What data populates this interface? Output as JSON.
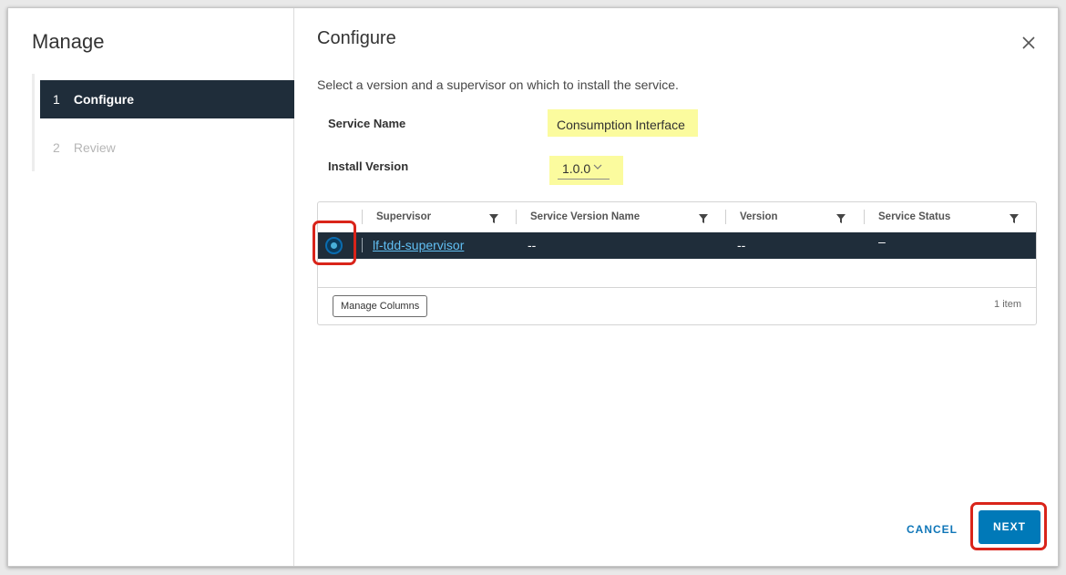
{
  "sidebar": {
    "title": "Manage",
    "steps": [
      {
        "number": "1",
        "label": "Configure",
        "active": true
      },
      {
        "number": "2",
        "label": "Review",
        "active": false
      }
    ]
  },
  "main": {
    "title": "Configure",
    "description": "Select a version and a supervisor on which to install the service.",
    "service_name_label": "Service Name",
    "service_name_value": "Consumption Interface",
    "install_version_label": "Install Version",
    "install_version_value": "1.0.0",
    "icons": {
      "close": "close-icon",
      "version_dropdown": "chevron-down-icon",
      "filter": "filter-icon"
    }
  },
  "grid": {
    "columns": [
      "Supervisor",
      "Service Version Name",
      "Version",
      "Service Status"
    ],
    "rows": [
      {
        "supervisor": "lf-tdd-supervisor",
        "service_version_name": "--",
        "version": "--",
        "service_status": "–",
        "selected": true
      }
    ],
    "manage_columns_label": "Manage Columns",
    "item_count": "1 item"
  },
  "footer": {
    "cancel_label": "CANCEL",
    "next_label": "NEXT"
  },
  "colors": {
    "nav_active": "#1f2d3a",
    "primary": "#0079b8",
    "link": "#61bff3",
    "highlight": "#fbfb9e",
    "callout": "#d9241a"
  }
}
